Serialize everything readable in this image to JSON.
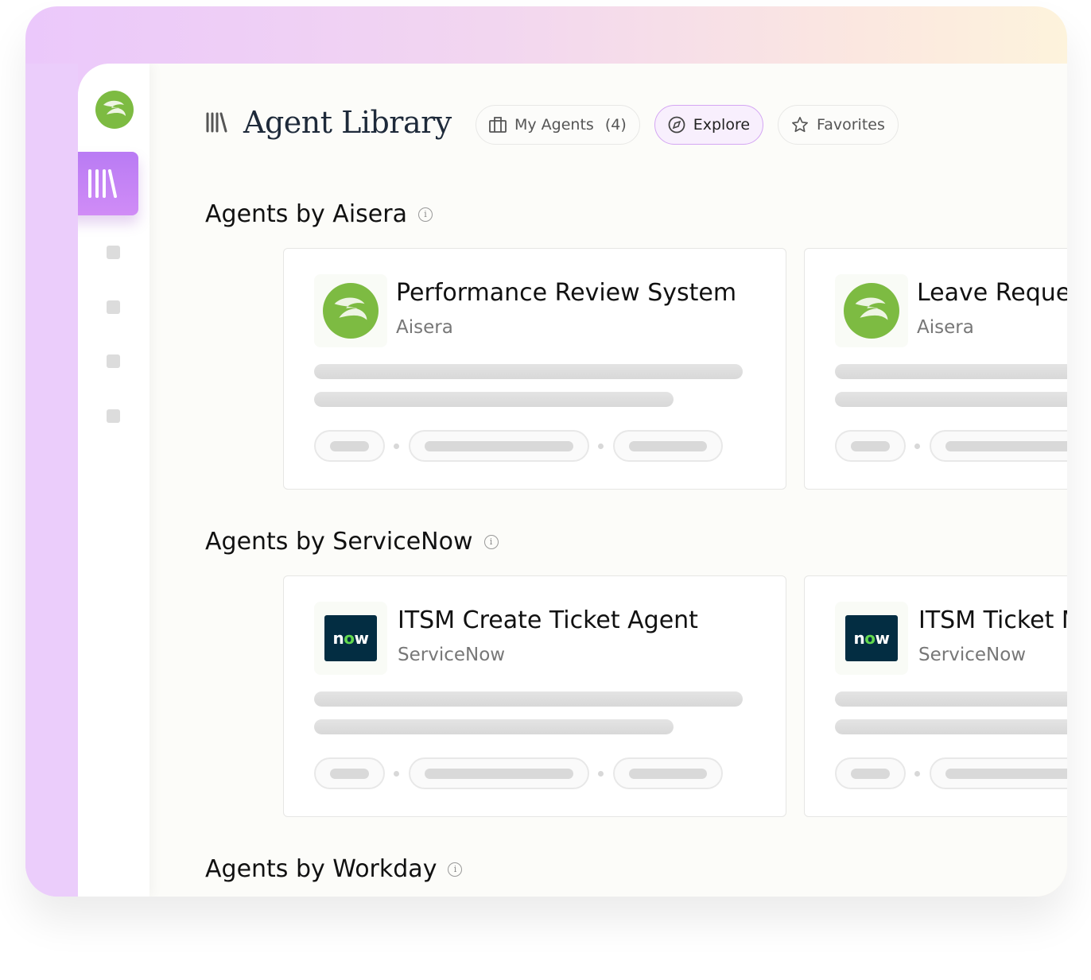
{
  "header": {
    "title": "Agent Library",
    "library_icon": "library-books-icon"
  },
  "tabs": [
    {
      "label": "My Agents",
      "count": "(4)",
      "icon": "briefcase-icon"
    },
    {
      "label": "Explore",
      "icon": "compass-icon",
      "active": true
    },
    {
      "label": "Favorites",
      "icon": "star-icon"
    }
  ],
  "sections": [
    {
      "title": "Agents by Aisera",
      "cards": [
        {
          "name": "Performance Review System",
          "org": "Aisera"
        },
        {
          "name": "Leave Request Agent",
          "org": "Aisera"
        }
      ]
    },
    {
      "title": "Agents by ServiceNow",
      "cards": [
        {
          "name": "ITSM Create Ticket Agent",
          "org": "ServiceNow"
        },
        {
          "name": "ITSM Ticket Management",
          "org": "ServiceNow"
        }
      ]
    },
    {
      "title": "Agents by Workday"
    }
  ],
  "logos": {
    "servicenow": "now"
  },
  "colors": {
    "accent": "#c184f5",
    "aisera_green": "#7dbb42",
    "servicenow_bg": "#032d42"
  }
}
